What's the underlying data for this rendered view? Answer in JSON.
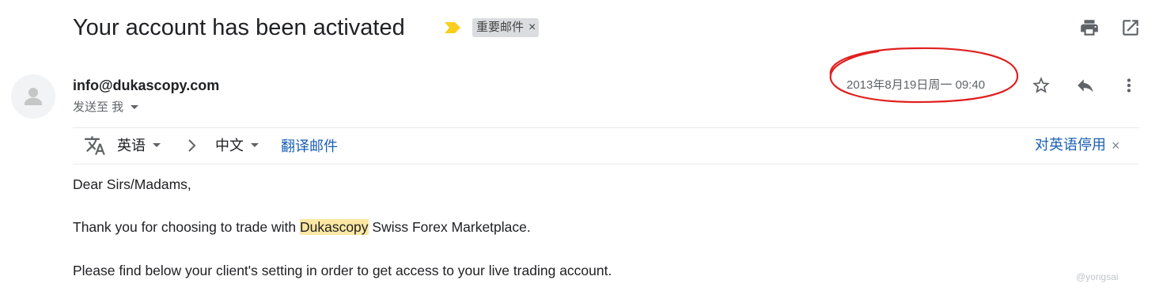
{
  "email": {
    "subject": "Your account has been activated",
    "label": "重要邮件",
    "label_close": "×",
    "sender": "info@dukascopy.com",
    "recipient": "发送至 我",
    "date": "2013年8月19日周一 09:40"
  },
  "translate_bar": {
    "source_lang": "英语",
    "target_lang": "中文",
    "translate_link": "翻译邮件",
    "turn_off_link": "对英语停用",
    "close": "×"
  },
  "body": {
    "greeting": "Dear Sirs/Madams,",
    "line1_before": "Thank you for choosing to trade with ",
    "line1_highlight": "Dukascopy",
    "line1_after": " Swiss Forex Marketplace.",
    "line2": "Please find below your client's setting in order to get access to your live trading account."
  },
  "watermark": "@yongsai",
  "colors": {
    "annotation_circle": "#e02020",
    "highlight": "#fce8a3",
    "link": "#1a5fb4",
    "important_marker": "#f9ce1d"
  },
  "icons": [
    "important-marker-icon",
    "print-icon",
    "open-in-new-window-icon",
    "avatar-icon",
    "chevron-down-icon",
    "star-icon",
    "reply-icon",
    "more-vert-icon",
    "translate-icon",
    "chevron-right-icon",
    "close-icon"
  ]
}
